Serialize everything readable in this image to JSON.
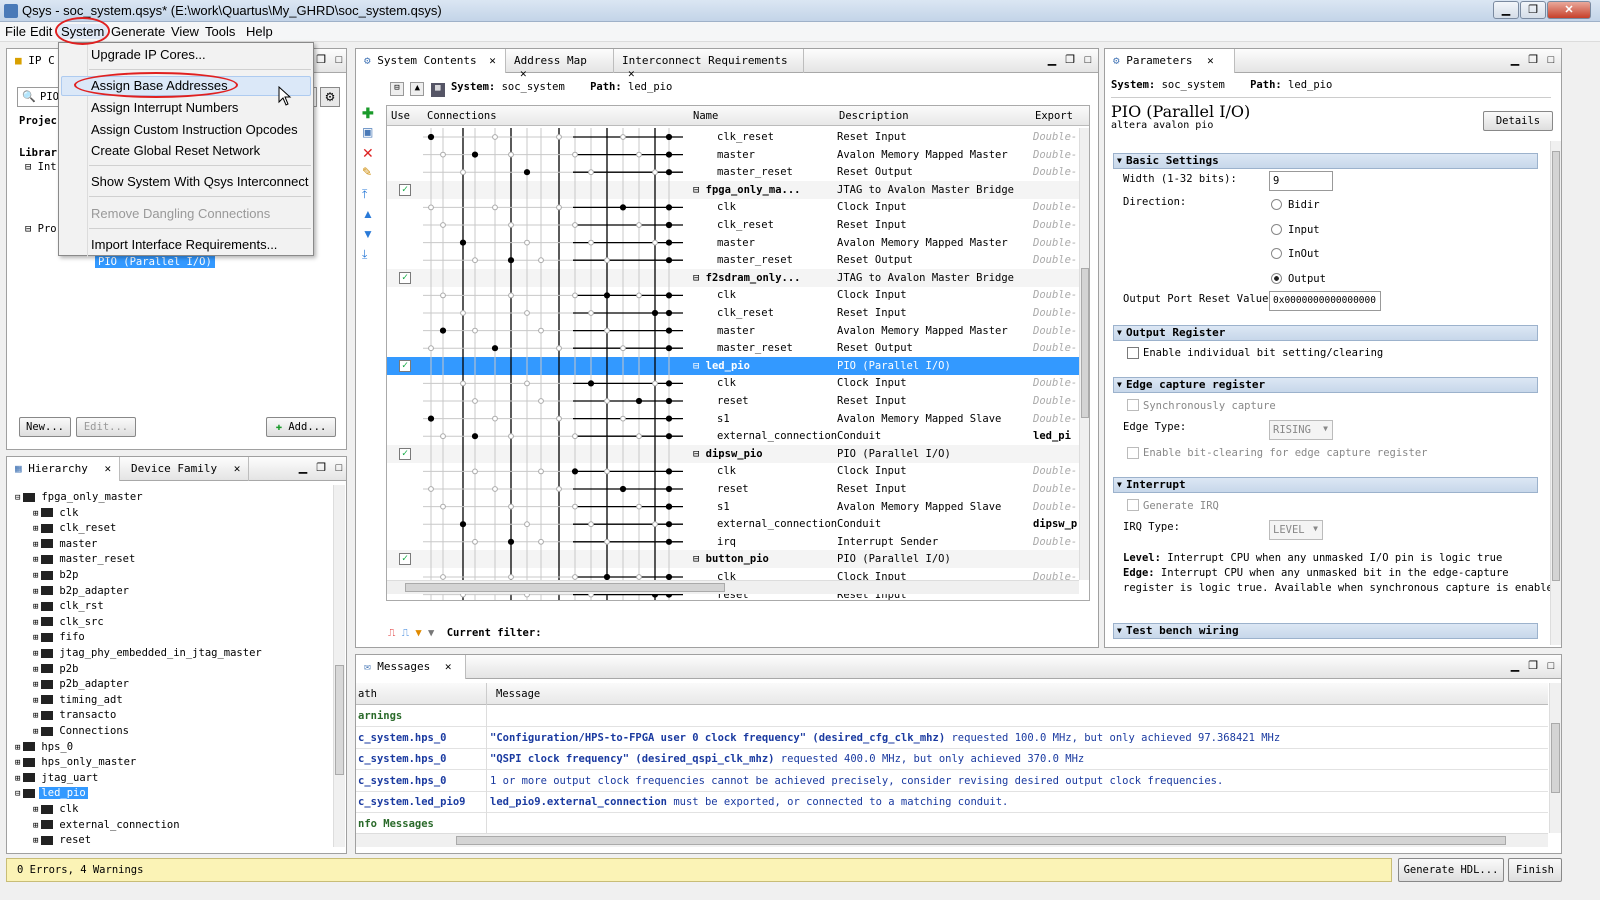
{
  "window": {
    "title": "Qsys - soc_system.qsys* (E:\\work\\Quartus\\My_GHRD\\soc_system.qsys)"
  },
  "menu": [
    "File",
    "Edit",
    "System",
    "Generate",
    "View",
    "Tools",
    "Help"
  ],
  "system_menu": {
    "items": [
      "Upgrade IP Cores...",
      "Assign Base Addresses",
      "Assign Interrupt Numbers",
      "Assign Custom Instruction Opcodes",
      "Create Global Reset Network",
      "Show System With Qsys Interconnect",
      "Remove Dangling Connections",
      "Import Interface Requirements..."
    ]
  },
  "ip_catalog": {
    "tab": "IP C",
    "search": "PIO",
    "project": "Projec",
    "library": "Librar",
    "int": "Int",
    "pro": "Pro",
    "selected": "PIO (Parallel I/O)",
    "buttons": {
      "new": "New...",
      "edit": "Edit...",
      "add": "Add..."
    }
  },
  "hierarchy": {
    "tabs": [
      "Hierarchy",
      "Device Family"
    ],
    "items": [
      {
        "t": "fpga_only_master",
        "lvl": 0,
        "exp": "⊟"
      },
      {
        "t": "clk",
        "lvl": 1
      },
      {
        "t": "clk_reset",
        "lvl": 1
      },
      {
        "t": "master",
        "lvl": 1
      },
      {
        "t": "master_reset",
        "lvl": 1
      },
      {
        "t": "b2p",
        "lvl": 1
      },
      {
        "t": "b2p_adapter",
        "lvl": 1
      },
      {
        "t": "clk_rst",
        "lvl": 1
      },
      {
        "t": "clk_src",
        "lvl": 1
      },
      {
        "t": "fifo",
        "lvl": 1
      },
      {
        "t": "jtag_phy_embedded_in_jtag_master",
        "lvl": 1
      },
      {
        "t": "p2b",
        "lvl": 1
      },
      {
        "t": "p2b_adapter",
        "lvl": 1
      },
      {
        "t": "timing_adt",
        "lvl": 1
      },
      {
        "t": "transacto",
        "lvl": 1
      },
      {
        "t": "Connections",
        "lvl": 1
      },
      {
        "t": "hps_0",
        "lvl": 0,
        "exp": "⊞"
      },
      {
        "t": "hps_only_master",
        "lvl": 0,
        "exp": "⊞"
      },
      {
        "t": "jtag_uart",
        "lvl": 0,
        "exp": "⊞"
      },
      {
        "t": "led_pio",
        "lvl": 0,
        "exp": "⊟",
        "sel": true
      },
      {
        "t": "clk",
        "lvl": 1
      },
      {
        "t": "external_connection",
        "lvl": 1
      },
      {
        "t": "reset",
        "lvl": 1
      }
    ]
  },
  "system_contents": {
    "tabs": [
      "System Contents",
      "Address Map",
      "Interconnect Requirements"
    ],
    "system": "System:",
    "system_name": "soc_system",
    "path": "Path:",
    "path_name": "led_pio",
    "headers": [
      "Use",
      "Connections",
      "Name",
      "Description",
      "Export"
    ],
    "rows": [
      {
        "n": "clk_reset",
        "d": "Reset Input",
        "e": "Double-"
      },
      {
        "n": "master",
        "d": "Avalon Memory Mapped Master",
        "e": "Double-"
      },
      {
        "n": "master_reset",
        "d": "Reset Output",
        "e": "Double-"
      },
      {
        "n": "fpga_only_ma...",
        "d": "JTAG to Avalon Master Bridge",
        "e": "",
        "top": true
      },
      {
        "n": "clk",
        "d": "Clock Input",
        "e": "Double-"
      },
      {
        "n": "clk_reset",
        "d": "Reset Input",
        "e": "Double-"
      },
      {
        "n": "master",
        "d": "Avalon Memory Mapped Master",
        "e": "Double-"
      },
      {
        "n": "master_reset",
        "d": "Reset Output",
        "e": "Double-"
      },
      {
        "n": "f2sdram_only...",
        "d": "JTAG to Avalon Master Bridge",
        "e": "",
        "top": true
      },
      {
        "n": "clk",
        "d": "Clock Input",
        "e": "Double-"
      },
      {
        "n": "clk_reset",
        "d": "Reset Input",
        "e": "Double-"
      },
      {
        "n": "master",
        "d": "Avalon Memory Mapped Master",
        "e": "Double-"
      },
      {
        "n": "master_reset",
        "d": "Reset Output",
        "e": "Double-"
      },
      {
        "n": "led_pio",
        "d": "PIO (Parallel I/O)",
        "e": "",
        "top": true,
        "sel": true
      },
      {
        "n": "clk",
        "d": "Clock Input",
        "e": "Double-"
      },
      {
        "n": "reset",
        "d": "Reset Input",
        "e": "Double-"
      },
      {
        "n": "s1",
        "d": "Avalon Memory Mapped Slave",
        "e": "Double-"
      },
      {
        "n": "external_connection",
        "d": "Conduit",
        "e": "led_pi"
      },
      {
        "n": "dipsw_pio",
        "d": "PIO (Parallel I/O)",
        "e": "",
        "top": true
      },
      {
        "n": "clk",
        "d": "Clock Input",
        "e": "Double-"
      },
      {
        "n": "reset",
        "d": "Reset Input",
        "e": "Double-"
      },
      {
        "n": "s1",
        "d": "Avalon Memory Mapped Slave",
        "e": "Double-"
      },
      {
        "n": "external_connection",
        "d": "Conduit",
        "e": "dipsw_p"
      },
      {
        "n": "irq",
        "d": "Interrupt Sender",
        "e": "Double-"
      },
      {
        "n": "button_pio",
        "d": "PIO (Parallel I/O)",
        "e": "",
        "top": true
      },
      {
        "n": "clk",
        "d": "Clock Input",
        "e": "Double-"
      },
      {
        "n": "reset",
        "d": "Reset Input",
        "e": ""
      }
    ],
    "filter": "Current filter:"
  },
  "parameters": {
    "tab": "Parameters",
    "system": "System:",
    "system_name": "soc_system",
    "path": "Path:",
    "path_name": "led_pio",
    "title": "PIO (Parallel I/O)",
    "subtitle": "altera avalon pio",
    "details": "Details",
    "basic": "Basic Settings",
    "width_label": "Width (1-32 bits):",
    "width": "9",
    "direction_label": "Direction:",
    "dirs": [
      "Bidir",
      "Input",
      "InOut",
      "Output"
    ],
    "reset_label": "Output Port Reset Value:",
    "reset_value": "0x0000000000000000",
    "outreg": "Output Register",
    "outreg_opt": "Enable individual bit setting/clearing",
    "edge": "Edge capture register",
    "sync": "Synchronously capture",
    "edge_type_label": "Edge Type:",
    "edge_type": "RISING",
    "bitclear": "Enable bit-clearing for edge capture register",
    "interrupt": "Interrupt",
    "gen_irq": "Generate IRQ",
    "irq_type_label": "IRQ Type:",
    "irq_type": "LEVEL",
    "level_b": "Level:",
    "level_t": " Interrupt CPU when any unmasked I/O pin is logic true",
    "edge_b": "Edge:",
    "edge_t": " Interrupt CPU when any unmasked bit in the edge-capture",
    "edge_t2": "register is logic true. Available when synchronous capture is enabled",
    "testbench": "Test bench wiring"
  },
  "messages": {
    "tab": "Messages",
    "col_path": "ath",
    "col_message": "Message",
    "rows": [
      {
        "p": "arnings",
        "m": "",
        "mono": false
      },
      {
        "p": "c_system.hps_0",
        "mb": "\"Configuration/HPS-to-FPGA user 0 clock frequency\" (desired_cfg_clk_mhz)",
        "m": " requested 100.0 MHz, but only achieved 97.368421 MHz"
      },
      {
        "p": "c_system.hps_0",
        "mb": "\"QSPI clock frequency\" (desired_qspi_clk_mhz)",
        "m": " requested 400.0 MHz, but only achieved 370.0 MHz"
      },
      {
        "p": "c_system.hps_0",
        "mb": "",
        "m": "1 or more output clock frequencies cannot be achieved precisely, consider revising desired output clock frequencies."
      },
      {
        "p": "c_system.led_pio9",
        "mb": "led_pio9.external_connection",
        "m": " must be exported, or connected to a matching conduit."
      },
      {
        "p": "nfo Messages",
        "mb": "",
        "m": ""
      }
    ]
  },
  "status": {
    "text": "0 Errors, 4 Warnings",
    "generate": "Generate HDL...",
    "finish": "Finish"
  }
}
